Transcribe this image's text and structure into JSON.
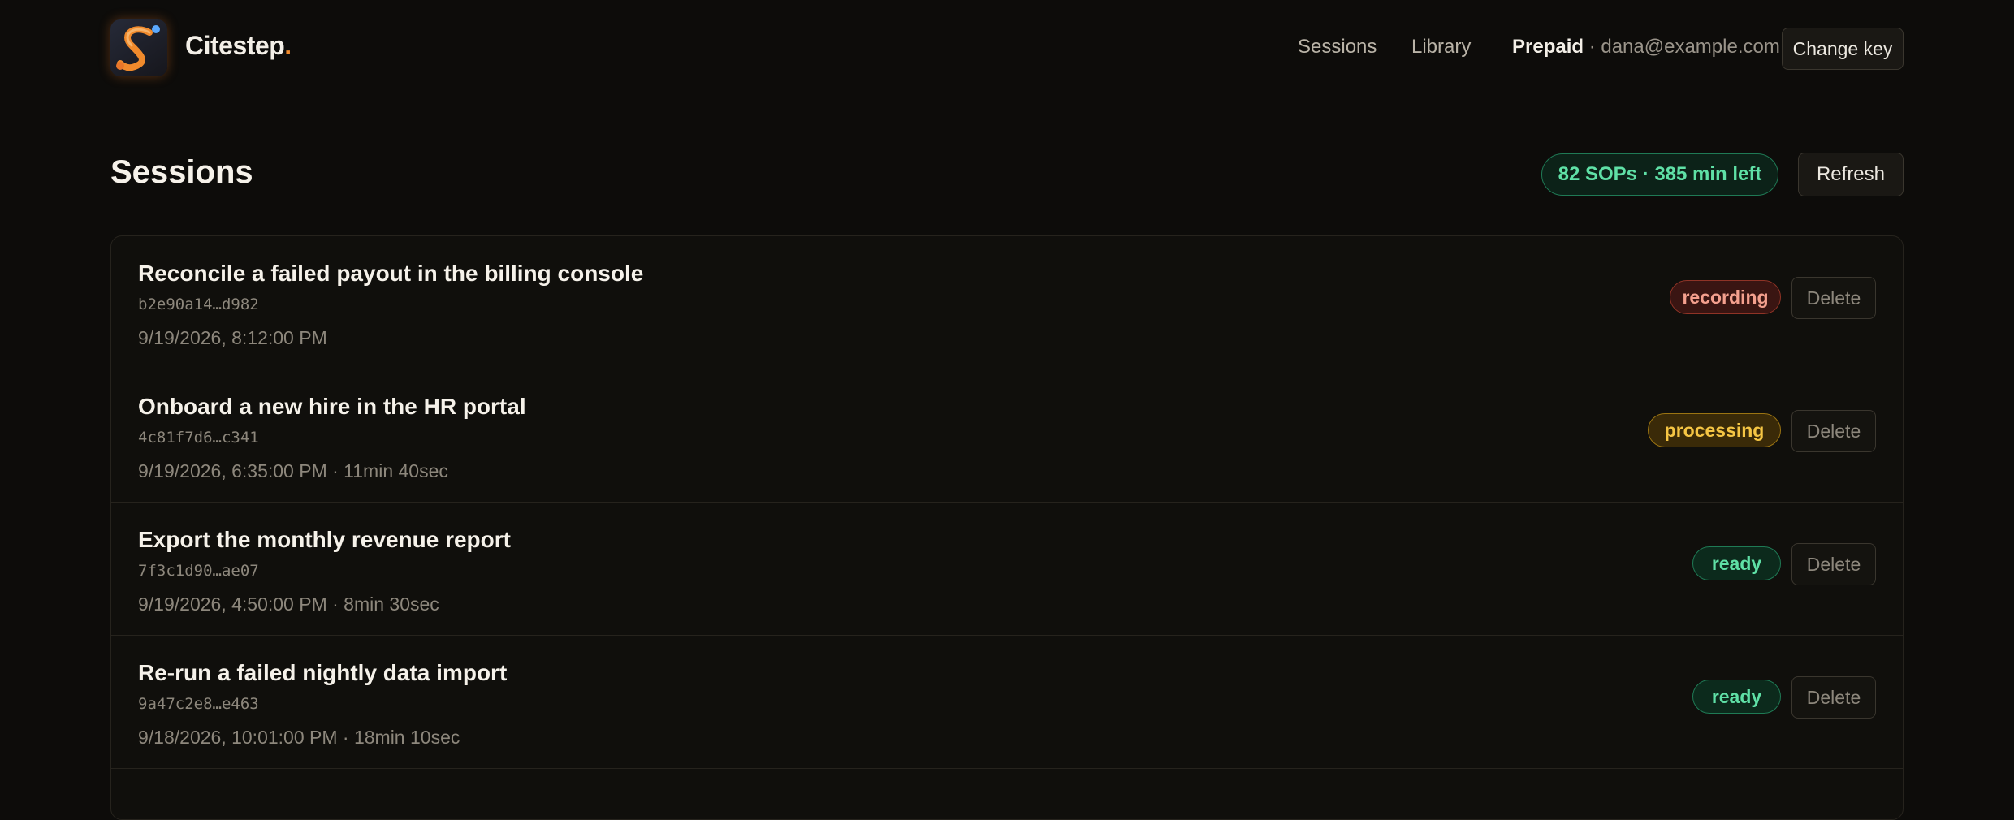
{
  "app": {
    "brand_name": "Citestep",
    "brand_dot": ".",
    "logo_icon": "s-path-logo-icon",
    "accent_color": "#f08a2c"
  },
  "nav": {
    "sessions": "Sessions",
    "library": "Library"
  },
  "account": {
    "plan": "Prepaid",
    "separator": " · ",
    "email": "dana@example.com",
    "change_key_label": "Change key"
  },
  "page": {
    "title": "Sessions",
    "quota": "82 SOPs · 385 min left",
    "refresh_label": "Refresh"
  },
  "sessions": [
    {
      "title": "Reconcile a failed payout in the billing console",
      "id": "b2e90a14…d982",
      "meta": "9/19/2026, 8:12:00 PM",
      "status": "recording",
      "delete_label": "Delete"
    },
    {
      "title": "Onboard a new hire in the HR portal",
      "id": "4c81f7d6…c341",
      "meta": "9/19/2026, 6:35:00 PM · 11min 40sec",
      "status": "processing",
      "delete_label": "Delete"
    },
    {
      "title": "Export the monthly revenue report",
      "id": "7f3c1d90…ae07",
      "meta": "9/19/2026, 4:50:00 PM · 8min 30sec",
      "status": "ready",
      "delete_label": "Delete"
    },
    {
      "title": "Re-run a failed nightly data import",
      "id": "9a47c2e8…e463",
      "meta": "9/18/2026, 10:01:00 PM · 18min 10sec",
      "status": "ready",
      "delete_label": "Delete"
    }
  ],
  "colors": {
    "recording": "#f4a08e",
    "processing": "#f5c544",
    "ready": "#5fe0a6"
  }
}
